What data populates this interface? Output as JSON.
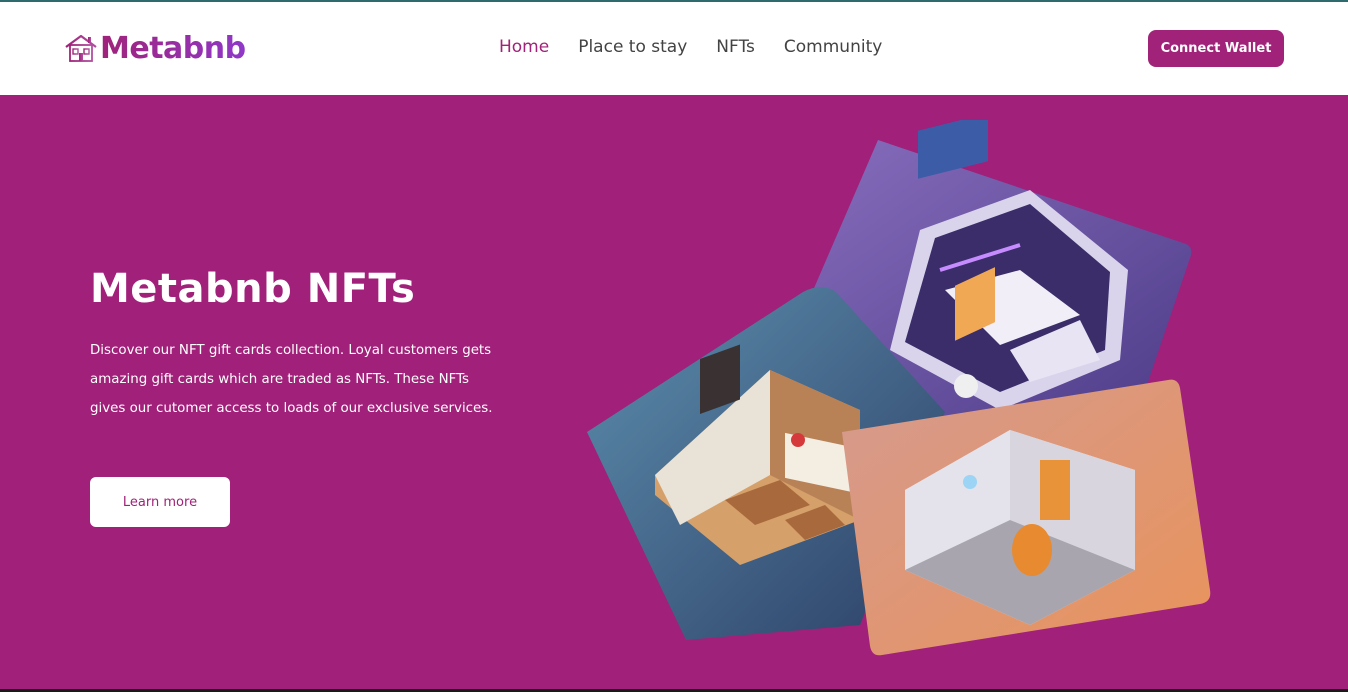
{
  "header": {
    "logo_text": "Metabnb",
    "nav": [
      {
        "label": "Home",
        "active": true
      },
      {
        "label": "Place to stay",
        "active": false
      },
      {
        "label": "NFTs",
        "active": false
      },
      {
        "label": "Community",
        "active": false
      }
    ],
    "connect_label": "Connect Wallet"
  },
  "hero": {
    "title": "Metabnb NFTs",
    "description": "Discover our NFT gift cards collection. Loyal customers gets amazing gift cards which are traded as NFTs. These NFTs gives our cutomer access to loads of our exclusive services.",
    "cta_label": "Learn more"
  },
  "colors": {
    "brand": "#a02279",
    "accent_purple": "#8f38c9",
    "hero_bg": "#a0207a",
    "nav_text": "#434343"
  },
  "icons": [
    "house-icon"
  ]
}
